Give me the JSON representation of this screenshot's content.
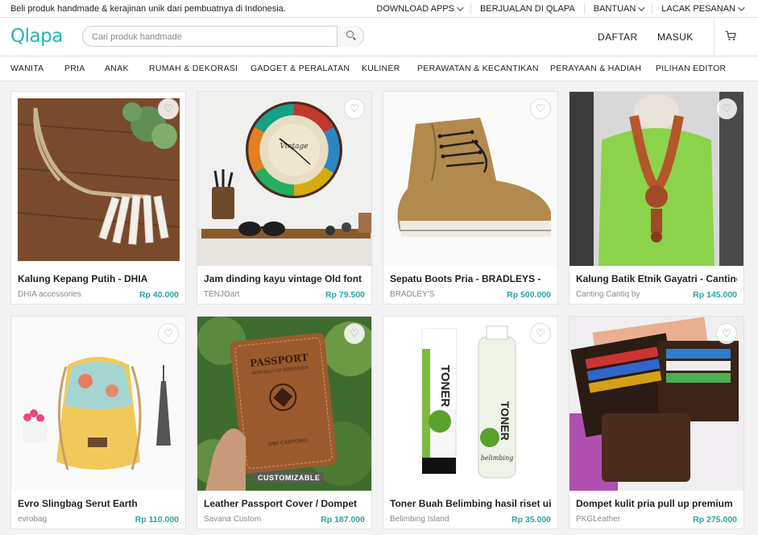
{
  "topbar": {
    "tagline": "Beli produk handmade & kerajinan unik dari pembuatnya di Indonesia.",
    "links": [
      {
        "label": "DOWNLOAD APPS"
      },
      {
        "label": "BERJUALAN DI QLAPA"
      },
      {
        "label": "BANTUAN"
      },
      {
        "label": "LACAK PESANAN"
      }
    ]
  },
  "header": {
    "logo": "Qlapa",
    "search_placeholder": "Cari produk handmade",
    "register": "DAFTAR",
    "login": "MASUK",
    "cart_icon": "cart-icon"
  },
  "categories": [
    "WANITA",
    "PRIA",
    "ANAK",
    "RUMAH & DEKORASI",
    "GADGET & PERALATAN",
    "KULINER",
    "PERAWATAN & KECANTIKAN",
    "PERAYAAN & HADIAH",
    "PILIHAN EDITOR"
  ],
  "products": [
    {
      "title": "Kalung Kepang Putih - DHIA",
      "shop": "DHIA accessories",
      "price": "Rp 40.000"
    },
    {
      "title": "Jam dinding kayu vintage Old font",
      "shop": "TENJOart",
      "price": "Rp 79.500"
    },
    {
      "title": "Sepatu Boots Pria - BRADLEYS -",
      "shop": "BRADLEY'S",
      "price": "Rp 500.000"
    },
    {
      "title": "Kalung Batik Etnik Gayatri - Canting",
      "shop": "Canting Cantiq by",
      "price": "Rp 145.000"
    },
    {
      "title": "Evro Slingbag Serut Earth",
      "shop": "evrobag",
      "price": "Rp 110.000"
    },
    {
      "title": "Leather Passport Cover / Dompet",
      "shop": "Savana Custom",
      "price": "Rp 187.000",
      "badge": "CUSTOMIZABLE"
    },
    {
      "title": "Toner Buah Belimbing hasil riset ui",
      "shop": "Belimbing Island",
      "price": "Rp 35.000"
    },
    {
      "title": "Dompet kulit pria pull up premium",
      "shop": "PKGLeather",
      "price": "Rp 275.000"
    }
  ],
  "image_text": {
    "clock_brand": "Vintage",
    "passport_title": "PASSPORT",
    "passport_sub": "REPUBLIC OF INDONESIA",
    "passport_name": "DWI CAHYONO",
    "toner_box": "TONER",
    "toner_bottle": "TONER",
    "toner_brand": "belimbing"
  }
}
